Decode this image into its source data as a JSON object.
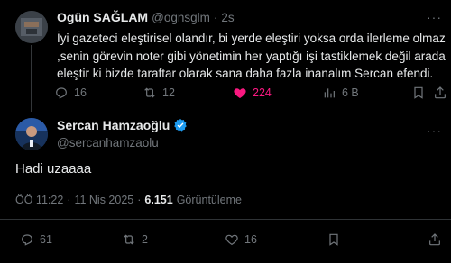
{
  "reply": {
    "display_name": "Ogün SAĞLAM",
    "handle": "@ognsglm",
    "separator": "·",
    "time": "2s",
    "text_lines": [
      "İyi gazeteci eleştirisel olandır, bi yerde eleştiri yoksa orda ilerleme olmaz",
      ",senin görevin noter gibi yönetimin her yaptığı işi tastiklemek değil arada",
      "eleştir ki bizde taraftar olarak sana daha fazla inanalım Sercan efendi."
    ],
    "stats": {
      "replies": "16",
      "reposts": "12",
      "likes": "224",
      "views": "6 B"
    },
    "liked": true
  },
  "main": {
    "display_name": "Sercan Hamzaoğlu",
    "handle": "@sercanhamzaolu",
    "verified": true,
    "text": "Hadi uzaaaa",
    "meta": {
      "time": "ÖÖ 11:22",
      "date": "11 Nis 2025",
      "separator": "·",
      "views_count": "6.151",
      "views_label": "Görüntüleme"
    },
    "stats": {
      "replies": "61",
      "reposts": "2",
      "likes": "16"
    }
  },
  "colors": {
    "background": "#000000",
    "text": "#e7e9ea",
    "muted": "#71767b",
    "like": "#f91880",
    "verified": "#1d9bf0",
    "divider": "#2f3336"
  },
  "icons": [
    "reply-icon",
    "repost-icon",
    "heart-icon",
    "views-icon",
    "bookmark-icon",
    "share-icon",
    "verified-badge-icon",
    "more-icon"
  ]
}
